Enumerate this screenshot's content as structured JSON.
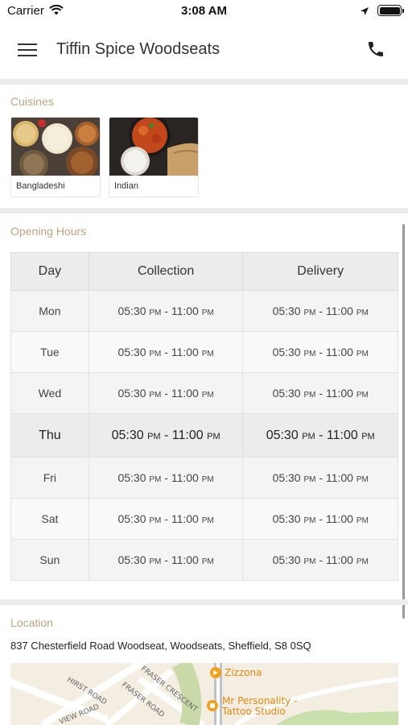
{
  "status_bar": {
    "carrier": "Carrier",
    "time": "3:08 AM"
  },
  "nav": {
    "title": "Tiffin Spice Woodseats",
    "menu_icon": "hamburger-menu-icon",
    "phone_icon": "phone-icon"
  },
  "cuisines": {
    "label": "Cuisines",
    "items": [
      {
        "name": "Bangladeshi"
      },
      {
        "name": "Indian"
      }
    ]
  },
  "opening_hours": {
    "label": "Opening Hours",
    "headers": {
      "day": "Day",
      "collection": "Collection",
      "delivery": "Delivery"
    },
    "rows": [
      {
        "day": "Mon",
        "c_start": "05:30",
        "c_start_ampm": "PM",
        "c_end": "11:00",
        "c_end_ampm": "PM",
        "d_start": "05:30",
        "d_start_ampm": "PM",
        "d_end": "11:00",
        "d_end_ampm": "PM",
        "today": false
      },
      {
        "day": "Tue",
        "c_start": "05:30",
        "c_start_ampm": "PM",
        "c_end": "11:00",
        "c_end_ampm": "PM",
        "d_start": "05:30",
        "d_start_ampm": "PM",
        "d_end": "11:00",
        "d_end_ampm": "PM",
        "today": false
      },
      {
        "day": "Wed",
        "c_start": "05:30",
        "c_start_ampm": "PM",
        "c_end": "11:00",
        "c_end_ampm": "PM",
        "d_start": "05:30",
        "d_start_ampm": "PM",
        "d_end": "11:00",
        "d_end_ampm": "PM",
        "today": false
      },
      {
        "day": "Thu",
        "c_start": "05:30",
        "c_start_ampm": "PM",
        "c_end": "11:00",
        "c_end_ampm": "PM",
        "d_start": "05:30",
        "d_start_ampm": "PM",
        "d_end": "11:00",
        "d_end_ampm": "PM",
        "today": true
      },
      {
        "day": "Fri",
        "c_start": "05:30",
        "c_start_ampm": "PM",
        "c_end": "11:00",
        "c_end_ampm": "PM",
        "d_start": "05:30",
        "d_start_ampm": "PM",
        "d_end": "11:00",
        "d_end_ampm": "PM",
        "today": false
      },
      {
        "day": "Sat",
        "c_start": "05:30",
        "c_start_ampm": "PM",
        "c_end": "11:00",
        "c_end_ampm": "PM",
        "d_start": "05:30",
        "d_start_ampm": "PM",
        "d_end": "11:00",
        "d_end_ampm": "PM",
        "today": false
      },
      {
        "day": "Sun",
        "c_start": "05:30",
        "c_start_ampm": "PM",
        "c_end": "11:00",
        "c_end_ampm": "PM",
        "d_start": "05:30",
        "d_start_ampm": "PM",
        "d_end": "11:00",
        "d_end_ampm": "PM",
        "today": false
      }
    ]
  },
  "location": {
    "label": "Location",
    "address": "837 Chesterfield Road Woodseat, Woodseats, Sheffield, S8 0SQ",
    "map": {
      "streets": [
        "HIRST ROAD",
        "FRASER CRESCENT",
        "FRASER ROAD",
        "VIEW ROAD"
      ],
      "places": [
        {
          "name": "Zizzona",
          "icon": "restaurant-pin-icon"
        },
        {
          "name": "Mr Personality - Tattoo Studio",
          "icon": "shop-pin-icon"
        }
      ]
    }
  },
  "colors": {
    "section_label": "#b9a584",
    "table_header_bg": "#ececec",
    "map_pin": "#f0a21c"
  }
}
